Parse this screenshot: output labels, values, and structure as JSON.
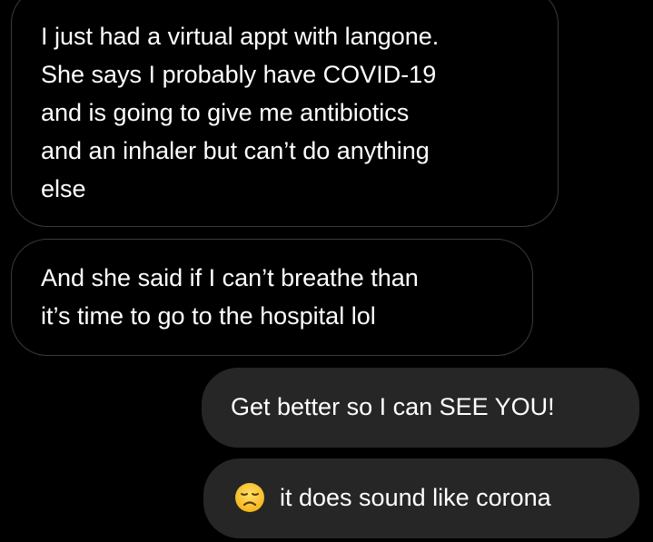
{
  "messages": [
    {
      "direction": "incoming",
      "text": "I just had a virtual appt with langone.\nShe says I probably have COVID-19\nand is going to give me antibiotics\nand an inhaler but can’t do anything\nelse"
    },
    {
      "direction": "incoming",
      "text": "And she said if I can’t breathe than\nit’s time to go to the hospital lol"
    },
    {
      "direction": "outgoing",
      "text": "Get better so I can SEE YOU!"
    },
    {
      "direction": "outgoing",
      "emoji": "disappointed-face-icon",
      "text": "it does sound like corona"
    }
  ],
  "colors": {
    "background": "#000000",
    "incoming_border": "#3a3a3c",
    "outgoing_bubble": "#262626",
    "text": "#ffffff",
    "emoji_face": "#f7c52b"
  }
}
